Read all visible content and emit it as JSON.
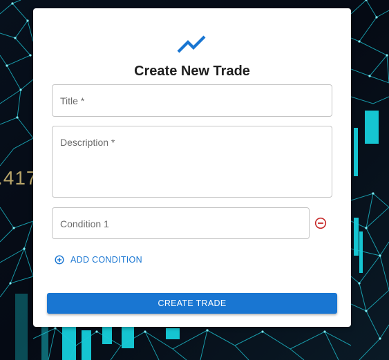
{
  "background": {
    "ticker_text": ".417"
  },
  "form": {
    "title": "Create New Trade",
    "header_icon": "trending-up-icon",
    "fields": {
      "title_placeholder": "Title *",
      "description_placeholder": "Description *",
      "condition_placeholder": "Condition 1"
    },
    "remove_icon": "remove-circle-outline-icon",
    "add_condition_icon": "add-circle-outline-icon",
    "add_condition_label": "ADD CONDITION",
    "submit_label": "CREATE TRADE"
  },
  "colors": {
    "accent": "#1976d2",
    "danger": "#c62828",
    "network": "#00c8d8"
  }
}
